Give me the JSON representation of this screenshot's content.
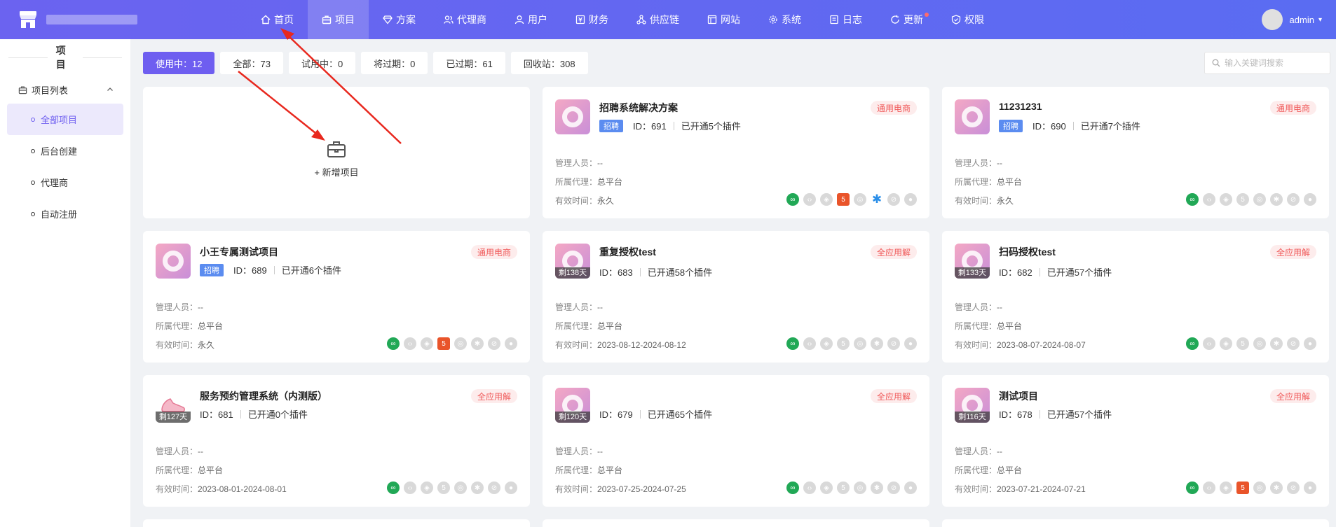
{
  "header": {
    "nav": [
      {
        "label": "首页",
        "icon": "home-icon"
      },
      {
        "label": "项目",
        "icon": "briefcase-icon",
        "active": true
      },
      {
        "label": "方案",
        "icon": "diamond-icon"
      },
      {
        "label": "代理商",
        "icon": "users-icon"
      },
      {
        "label": "用户",
        "icon": "user-icon"
      },
      {
        "label": "财务",
        "icon": "finance-icon"
      },
      {
        "label": "供应链",
        "icon": "chain-icon"
      },
      {
        "label": "网站",
        "icon": "web-icon"
      },
      {
        "label": "系统",
        "icon": "gear-icon"
      },
      {
        "label": "日志",
        "icon": "log-icon"
      },
      {
        "label": "更新",
        "icon": "refresh-icon",
        "dot": true
      },
      {
        "label": "权限",
        "icon": "shield-icon"
      }
    ],
    "user": {
      "name": "admin"
    }
  },
  "sidebar": {
    "title": "项目",
    "group": "项目列表",
    "items": [
      {
        "label": "全部项目",
        "active": true
      },
      {
        "label": "后台创建"
      },
      {
        "label": "代理商"
      },
      {
        "label": "自动注册"
      }
    ]
  },
  "filters": [
    {
      "label": "使用中：12",
      "active": true
    },
    {
      "label": "全部：73"
    },
    {
      "label": "试用中：0"
    },
    {
      "label": "将过期：0"
    },
    {
      "label": "已过期：61"
    },
    {
      "label": "回收站：308"
    }
  ],
  "search": {
    "placeholder": "输入关键词搜索"
  },
  "add_card": {
    "label": "+ 新增项目"
  },
  "labels": {
    "manager": "管理人员：",
    "agent": "所属代理：",
    "valid": "有效时间："
  },
  "cards": [
    {
      "title": "招聘系统解决方案",
      "type": "通用电商",
      "tag": "招聘",
      "id": "ID：691",
      "plugins": "已开通5个插件",
      "manager": "--",
      "agent": "总平台",
      "valid": "永久"
    },
    {
      "title": "11231231",
      "type": "通用电商",
      "tag": "招聘",
      "id": "ID：690",
      "plugins": "已开通7个插件",
      "manager": "--",
      "agent": "总平台",
      "valid": "永久"
    },
    {
      "title": "小王专属测试项目",
      "type": "通用电商",
      "tag": "招聘",
      "id": "ID：689",
      "plugins": "已开通6个插件",
      "manager": "--",
      "agent": "总平台",
      "valid": "永久"
    },
    {
      "title": "重复授权test",
      "type": "全应用解",
      "days": "剩138天",
      "id": "ID：683",
      "plugins": "已开通58个插件",
      "manager": "--",
      "agent": "总平台",
      "valid": "2023-08-12-2024-08-12"
    },
    {
      "title": "扫码授权test",
      "type": "全应用解",
      "days": "剩133天",
      "id": "ID：682",
      "plugins": "已开通57个插件",
      "manager": "--",
      "agent": "总平台",
      "valid": "2023-08-07-2024-08-07"
    },
    {
      "title": "服务预约管理系统（内测版）",
      "type": "全应用解",
      "days": "剩127天",
      "id": "ID：681",
      "plugins": "已开通0个插件",
      "manager": "--",
      "agent": "总平台",
      "valid": "2023-08-01-2024-08-01"
    },
    {
      "title": "",
      "type": "全应用解",
      "days": "剩120天",
      "id": "ID：679",
      "plugins": "已开通65个插件",
      "manager": "--",
      "agent": "总平台",
      "valid": "2023-07-25-2024-07-25"
    },
    {
      "title": "测试项目",
      "type": "全应用解",
      "days": "剩116天",
      "id": "ID：678",
      "plugins": "已开通57个插件",
      "manager": "--",
      "agent": "总平台",
      "valid": "2023-07-21-2024-07-21"
    }
  ],
  "colors": {
    "nav_bg": "#6b63f0",
    "accent": "#6e5ef0",
    "tag": "#5b8cf0",
    "badge": "#f05a5a",
    "arrow": "#e8281e"
  }
}
